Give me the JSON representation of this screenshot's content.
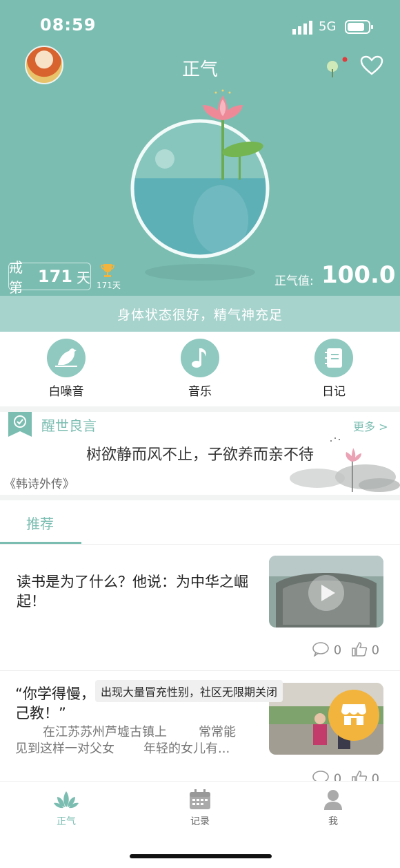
{
  "status_bar": {
    "time": "08:59",
    "network": "5G"
  },
  "header": {
    "title": "正气"
  },
  "streak": {
    "prefix": "戒第",
    "days": "171",
    "suffix": "天",
    "trophy_label": "171天"
  },
  "score": {
    "label": "正气值:",
    "value": "100.0"
  },
  "status_message": "身体状态很好，精气神充足",
  "shortcuts": [
    {
      "label": "白噪音",
      "icon": "bird-icon"
    },
    {
      "label": "音乐",
      "icon": "music-note-icon"
    },
    {
      "label": "日记",
      "icon": "notebook-icon"
    }
  ],
  "quote": {
    "title": "醒世良言",
    "more": "更多 >",
    "text": "树欲静而风不止，子欲养而亲不待",
    "source": "《韩诗外传》"
  },
  "tabs": {
    "recommend": "推荐"
  },
  "articles": [
    {
      "title": "读书是为了什么？他说：为中华之崛起！",
      "comments": "0",
      "likes": "0"
    },
    {
      "title": "“你学得慢，我就慢慢教，总能教会，只要你自己教！”",
      "title_visible": "“你学得慢，",
      "title_line2": "己教！”",
      "description": "在江苏苏州芦墟古镇上　　常常能见到这样一对父女　　年轻的女儿有...",
      "desc_line1": "在江苏苏州芦墟古镇上",
      "desc_line1b": "常常能",
      "desc_line2": "见到这样一对父女",
      "desc_line2b": "年轻的女儿有...",
      "comments": "0",
      "likes": "0"
    }
  ],
  "toast": "出现大量冒充性别，社区无限期关闭",
  "tabbar": [
    {
      "label": "正气",
      "icon": "lotus-icon",
      "active": true
    },
    {
      "label": "记录",
      "icon": "calendar-icon",
      "active": false
    },
    {
      "label": "我",
      "icon": "person-icon",
      "active": false
    }
  ],
  "colors": {
    "accent": "#7bbdb1",
    "fab": "#f2b43c"
  }
}
